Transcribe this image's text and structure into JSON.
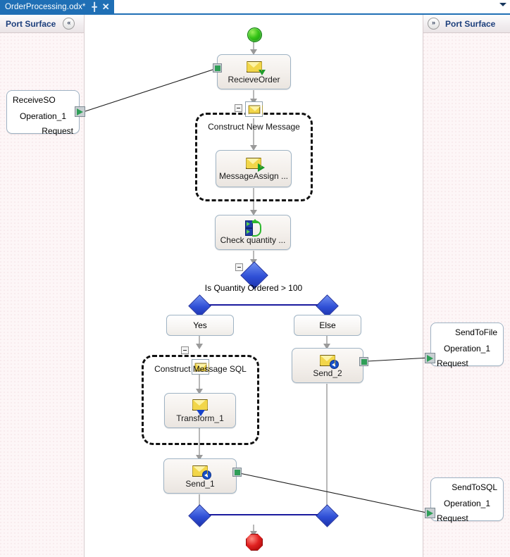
{
  "window": {
    "tab": {
      "title": "OrderProcessing.odx*",
      "pin_icon": "pin-icon",
      "close_icon": "close-icon"
    },
    "tabbar_dropdown_icon": "chevron-down-icon"
  },
  "left_panel": {
    "title": "Port Surface",
    "collapse_icon": "chevron-double-left-icon",
    "ports": [
      {
        "name": "ReceiveSO",
        "operation": "Operation_1",
        "message": "Request",
        "connector_icon": "port-connector-green-icon"
      }
    ]
  },
  "right_panel": {
    "title": "Port Surface",
    "expand_icon": "chevron-double-right-icon",
    "ports": [
      {
        "name": "SendToFile",
        "operation": "Operation_1",
        "message": "Request",
        "connector_icon": "port-connector-green-icon"
      },
      {
        "name": "SendToSQL",
        "operation": "Operation_1",
        "message": "Request",
        "connector_icon": "port-connector-green-icon"
      }
    ]
  },
  "orchestration": {
    "start_label": "begin-shape",
    "end_label": "end-shape",
    "shapes": {
      "receive_order": {
        "label": "RecieveOrder",
        "icon": "receive-message-icon"
      },
      "construct_new_message": {
        "label": "Construct New Message",
        "icon": "construct-message-icon",
        "collapse_icon": "collapse-minus-icon"
      },
      "message_assignment": {
        "label": "MessageAssign ...",
        "icon": "message-assignment-icon"
      },
      "check_quantity": {
        "label": "Check  quantity ...",
        "icon": "expression-loop-icon"
      },
      "decide": {
        "label": "Is Quantity Ordered > 100",
        "icon": "decide-diamond-icon",
        "collapse_icon": "collapse-minus-icon"
      },
      "branch_yes": {
        "label": "Yes"
      },
      "branch_else": {
        "label": "Else"
      },
      "construct_message_sql": {
        "label": "Construct Message SQL",
        "icon": "construct-message-icon",
        "collapse_icon": "collapse-minus-icon"
      },
      "transform": {
        "label": "Transform_1",
        "icon": "transform-icon"
      },
      "send_1": {
        "label": "Send_1",
        "icon": "send-message-icon"
      },
      "send_2": {
        "label": "Send_2",
        "icon": "send-message-icon"
      }
    }
  },
  "colors": {
    "tab_active": "#1f6fb5",
    "panel_title": "#1c3f7c",
    "branch_line": "#1a1a9e",
    "diamond": "#2f4fd6",
    "start": "#2cbb16",
    "end": "#e02020",
    "connector_green": "#2f9e57"
  }
}
